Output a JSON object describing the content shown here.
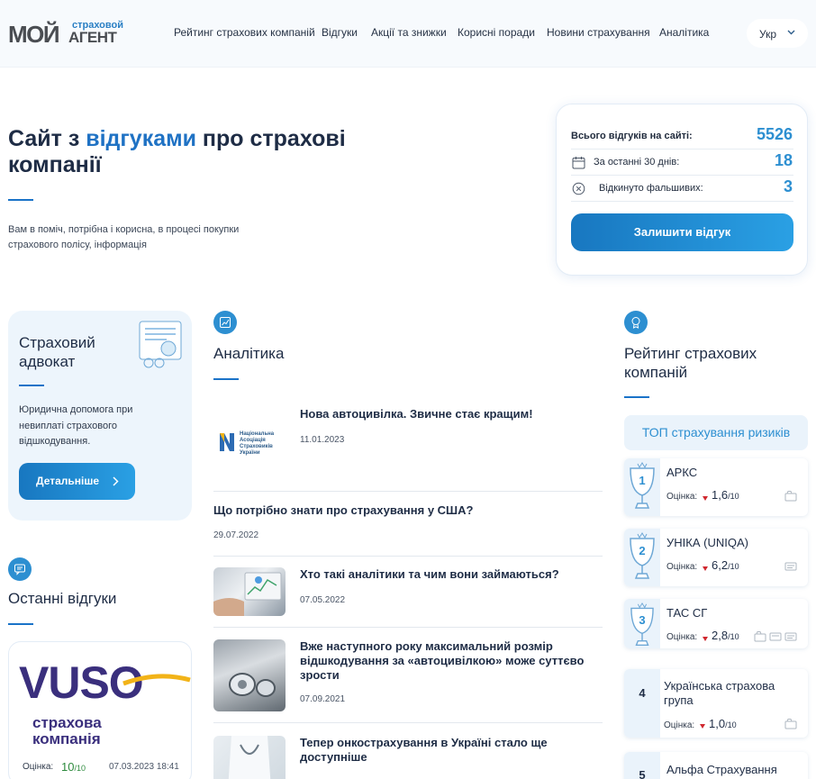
{
  "header": {
    "logo_main": "МОЙ",
    "logo_small": "страховой",
    "logo_big": "АГЕНТ",
    "nav": [
      "Рейтинг страхових компаній",
      "Відгуки",
      "Акції та знижки",
      "Корисні поради",
      "Новини страхування",
      "Аналітика"
    ],
    "lang": "Укр"
  },
  "hero": {
    "title_part1": "Сайт з ",
    "title_highlight": "відгуками",
    "title_part2": " про страхові компанії",
    "subtitle": "Вам в поміч, потрібна і корисна, в процесі покупки страхового полісу, інформація"
  },
  "stats": {
    "total_label": "Всього відгуків на сайті:",
    "total_value": "5526",
    "last30_label": "За останні 30 днів:",
    "last30_value": "18",
    "rejected_label": "Відкинуто фальшивих:",
    "rejected_value": "3",
    "leave_button": "Залишити відгук"
  },
  "advocate": {
    "title": "Страховий адвокат",
    "description": "Юридична допомога при невиплаті страхового відшкодування.",
    "button": "Детальніше"
  },
  "recent_reviews": {
    "title": "Останні відгуки",
    "card": {
      "logo_text": "VUSO",
      "logo_sub1": "страхова",
      "logo_sub2": "компанія",
      "rating_label": "Оцінка:",
      "score": "10",
      "score_max": "/10",
      "date": "07.03.2023 18:41"
    }
  },
  "analytics": {
    "title": "Аналітика",
    "articles": [
      {
        "title": "Нова автоцивілка. Звичне стає кращим!",
        "date": "11.01.2023",
        "thumb_caption": "Національна Асоціація Страховиків України"
      },
      {
        "title": "Що потрібно знати про страхування у США?",
        "date": "29.07.2022"
      },
      {
        "title": "Хто такі аналітики та чим вони займаються?",
        "date": "07.05.2022"
      },
      {
        "title": "Вже наступного року максимальний розмір відшкодування за «автоцивілкою» може суттєво зрости",
        "date": "07.09.2021"
      },
      {
        "title": "Тепер онкострахування в Україні стало ще доступніше",
        "date": ""
      }
    ]
  },
  "rating": {
    "title": "Рейтинг страхових компаній",
    "top_label": "ТОП страхування ризиків",
    "rating_label": "Оцінка:",
    "companies": [
      {
        "rank": "1",
        "name": "АРКС",
        "score": "1,6",
        "max": "/10"
      },
      {
        "rank": "2",
        "name": "УНІКА (UNIQA)",
        "score": "6,2",
        "max": "/10"
      },
      {
        "rank": "3",
        "name": "ТАС СГ",
        "score": "2,8",
        "max": "/10"
      },
      {
        "rank": "4",
        "name": "Українська страхова група",
        "score": "1,0",
        "max": "/10"
      },
      {
        "rank": "5",
        "name": "Альфа Страхування",
        "score": "",
        "max": ""
      }
    ]
  },
  "colors": {
    "accent": "#2d8fd1",
    "title": "#1e2c45",
    "button_gradient_start": "#1877c0",
    "button_gradient_end": "#2aa0e4",
    "down_arrow": "#d0282f",
    "score_green": "#2e8b3e"
  }
}
